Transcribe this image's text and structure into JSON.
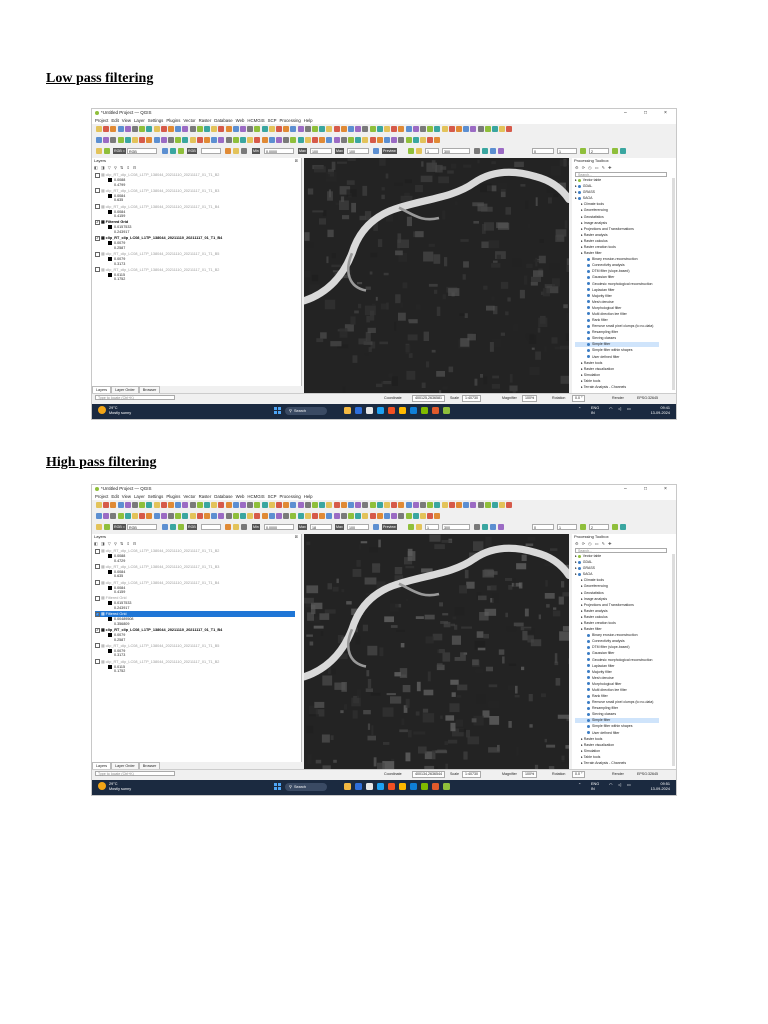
{
  "sections": [
    {
      "heading": "Low pass filtering",
      "qgis": {
        "window_title": "*Untitled Project — QGIS",
        "window_controls": [
          "–",
          "□",
          "×"
        ],
        "menu": [
          "Project",
          "Edit",
          "View",
          "Layer",
          "Settings",
          "Plugins",
          "Vector",
          "Raster",
          "Database",
          "Web",
          "HCMGIS",
          "SCP",
          "Processing",
          "Help"
        ],
        "toolbar3": {
          "rgb_label": "RGB =",
          "rgb_value": "RGB",
          "min_label": "Min",
          "min_value": "0.0000",
          "max_label": "Max",
          "max_value": "100",
          "max2_value": "100",
          "preview_label": "Preview",
          "band1": "1",
          "band2": "300",
          "band3": "0",
          "band4": "1",
          "band5": "2"
        },
        "layers_panel": {
          "title": "Layers",
          "tabs": [
            "Layers",
            "Layer Order",
            "Browser"
          ],
          "search_placeholder": "Type to locate (Ctrl+K)",
          "layers": [
            {
              "name": "clip_RT_clip_LC08_L1TP_138044_20211110_20211117_01_T1_B2",
              "checked": false,
              "style": "dim",
              "legend": [
                "0.0088",
                "0.4799"
              ]
            },
            {
              "name": "clip_RT_clip_LC08_L1TP_138044_20211110_20211117_01_T1_B3",
              "checked": false,
              "style": "dim",
              "legend": [
                "0.0084",
                "0.635"
              ]
            },
            {
              "name": "clip_RT_clip_LC08_L1TP_138044_20211110_20211117_01_T1_B4",
              "checked": false,
              "style": "dim",
              "legend": [
                "0.0084",
                "0.4159"
              ]
            },
            {
              "name": "Filtered Grid",
              "checked": true,
              "style": "bold",
              "legend": [
                "0.0157533",
                "0.243917"
              ]
            },
            {
              "name": "clip_RT_clip_LC08_L1TP_138044_20211110_20211117_01_T1_B4",
              "checked": true,
              "style": "bold",
              "legend": [
                "0.0079",
                "0.2587"
              ]
            },
            {
              "name": "clip_RT_clip_LC08_L1TP_138044_20211110_20211117_01_T1_B5",
              "checked": false,
              "style": "dim",
              "legend": [
                "0.0079",
                "0.3173"
              ]
            },
            {
              "name": "clip_RT_clip_LC08_L1TP_138044_20211110_20211117_01_T1_B2",
              "checked": false,
              "style": "dim",
              "legend": [
                "0.0115",
                "0.1752"
              ]
            }
          ]
        },
        "processing": {
          "title": "Processing Toolbox",
          "search_placeholder": "Search...",
          "tree": [
            {
              "label": "Vector table",
              "level": 0,
              "icon": "q"
            },
            {
              "label": "GDAL",
              "level": 0,
              "icon": "g"
            },
            {
              "label": "GRASS",
              "level": 0,
              "icon": "g"
            },
            {
              "label": "SAGA",
              "level": 0,
              "icon": "s"
            },
            {
              "label": "Climate tools",
              "level": 1
            },
            {
              "label": "Georeferencing",
              "level": 1
            },
            {
              "label": "Geostatistics",
              "level": 1
            },
            {
              "label": "Image analysis",
              "level": 1
            },
            {
              "label": "Projections and Transformations",
              "level": 1
            },
            {
              "label": "Raster analysis",
              "level": 1
            },
            {
              "label": "Raster calculus",
              "level": 1
            },
            {
              "label": "Raster creation tools",
              "level": 1
            },
            {
              "label": "Raster filter",
              "level": 1
            },
            {
              "label": "Binary erosion-reconstruction",
              "level": 2
            },
            {
              "label": "Connectivity analysis",
              "level": 2
            },
            {
              "label": "DTM filter (slope-based)",
              "level": 2
            },
            {
              "label": "Gaussian filter",
              "level": 2
            },
            {
              "label": "Geodesic morphological reconstruction",
              "level": 2
            },
            {
              "label": "Laplacian filter",
              "level": 2
            },
            {
              "label": "Majority filter",
              "level": 2
            },
            {
              "label": "Mesh denoise",
              "level": 2
            },
            {
              "label": "Morphological filter",
              "level": 2
            },
            {
              "label": "Multi direction lee filter",
              "level": 2
            },
            {
              "label": "Rank filter",
              "level": 2
            },
            {
              "label": "Remove small pixel clumps (to no-data)",
              "level": 2
            },
            {
              "label": "Resampling filter",
              "level": 2
            },
            {
              "label": "Sieving classes",
              "level": 2
            },
            {
              "label": "Simple filter",
              "level": 2,
              "highlight": true
            },
            {
              "label": "Simple filter within shapes",
              "level": 2
            },
            {
              "label": "User defined filter",
              "level": 2
            },
            {
              "label": "Raster tools",
              "level": 1
            },
            {
              "label": "Raster visualization",
              "level": 1
            },
            {
              "label": "Simulation",
              "level": 1
            },
            {
              "label": "Table tools",
              "level": 1
            },
            {
              "label": "Terrain Analysis - Channels",
              "level": 1
            }
          ]
        },
        "status": {
          "locate": "Type to locate (Ctrl+K)",
          "coordinate_label": "Coordinate",
          "coordinate": "400125,2636581",
          "scale_label": "Scale",
          "scale": "1:40730",
          "magnifier_label": "Magnifier",
          "magnifier": "100%",
          "rotation_label": "Rotation",
          "rotation": "0.0 °",
          "render_label": "Render",
          "crs": "EPSG:32645"
        },
        "taskbar": {
          "weather_temp": "29°C",
          "weather_desc": "Mostly sunny",
          "search": "Search",
          "lang": "ENG",
          "lang2": "IN",
          "time": "09:41",
          "date": "13-09-2024"
        }
      }
    },
    {
      "heading": "High pass filtering",
      "qgis": {
        "window_title": "*Untitled Project — QGIS",
        "window_controls": [
          "–",
          "□",
          "×"
        ],
        "menu": [
          "Project",
          "Edit",
          "View",
          "Layer",
          "Settings",
          "Plugins",
          "Vector",
          "Raster",
          "Database",
          "Web",
          "HCMGIS",
          "SCP",
          "Processing",
          "Help"
        ],
        "toolbar3": {
          "rgb_label": "RGB =",
          "rgb_value": "RGB",
          "min_label": "Min",
          "min_value": "0.0000",
          "max_label": "Max",
          "max_value": "18",
          "max2_value": "100",
          "preview_label": "Preview",
          "band1": "1",
          "band2": "300",
          "band3": "0",
          "band4": "1",
          "band5": "2"
        },
        "layers_panel": {
          "title": "Layers",
          "tabs": [
            "Layers",
            "Layer Order",
            "Browser"
          ],
          "search_placeholder": "Type to locate (Ctrl+K)",
          "layers": [
            {
              "name": "clip_RT_clip_LC08_L1TP_138044_20211110_20211117_01_T1_B2",
              "checked": false,
              "style": "dim",
              "legend": [
                "0.0088",
                "0.4729"
              ]
            },
            {
              "name": "clip_RT_clip_LC08_L1TP_138044_20211110_20211117_01_T1_B3",
              "checked": false,
              "style": "dim",
              "legend": [
                "0.0084",
                "0.635"
              ]
            },
            {
              "name": "clip_RT_clip_LC08_L1TP_138044_20211110_20211117_01_T1_B4",
              "checked": false,
              "style": "dim",
              "legend": [
                "0.0084",
                "0.4159"
              ]
            },
            {
              "name": "Filtered Grid",
              "checked": false,
              "style": "dim",
              "legend": [
                "0.0157533",
                "0.243917"
              ]
            },
            {
              "name": "Filtered Grid",
              "checked": true,
              "style": "sel",
              "legend": [
                "0.00489508",
                "0.356809"
              ]
            },
            {
              "name": "clip_RT_clip_LC08_L1TP_138044_20211110_20211117_01_T1_B4",
              "checked": true,
              "style": "bold",
              "legend": [
                "0.0079",
                "0.2587"
              ]
            },
            {
              "name": "clip_RT_clip_LC08_L1TP_138044_20211110_20211117_01_T1_B5",
              "checked": false,
              "style": "dim",
              "legend": [
                "0.0079",
                "0.3173"
              ]
            },
            {
              "name": "clip_RT_clip_LC08_L1TP_138044_20211110_20211117_01_T1_B2",
              "checked": false,
              "style": "dim",
              "legend": [
                "0.0115",
                "0.1752"
              ]
            }
          ]
        },
        "processing": {
          "title": "Processing Toolbox",
          "search_placeholder": "Search...",
          "tree": [
            {
              "label": "Vector table",
              "level": 0,
              "icon": "q"
            },
            {
              "label": "GDAL",
              "level": 0,
              "icon": "g"
            },
            {
              "label": "GRASS",
              "level": 0,
              "icon": "g"
            },
            {
              "label": "SAGA",
              "level": 0,
              "icon": "s"
            },
            {
              "label": "Climate tools",
              "level": 1
            },
            {
              "label": "Georeferencing",
              "level": 1
            },
            {
              "label": "Geostatistics",
              "level": 1
            },
            {
              "label": "Image analysis",
              "level": 1
            },
            {
              "label": "Projections and Transformations",
              "level": 1
            },
            {
              "label": "Raster analysis",
              "level": 1
            },
            {
              "label": "Raster calculus",
              "level": 1
            },
            {
              "label": "Raster creation tools",
              "level": 1
            },
            {
              "label": "Raster filter",
              "level": 1
            },
            {
              "label": "Binary erosion-reconstruction",
              "level": 2
            },
            {
              "label": "Connectivity analysis",
              "level": 2
            },
            {
              "label": "DTM filter (slope-based)",
              "level": 2
            },
            {
              "label": "Gaussian filter",
              "level": 2
            },
            {
              "label": "Geodesic morphological reconstruction",
              "level": 2
            },
            {
              "label": "Laplacian filter",
              "level": 2
            },
            {
              "label": "Majority filter",
              "level": 2
            },
            {
              "label": "Mesh denoise",
              "level": 2
            },
            {
              "label": "Morphological filter",
              "level": 2
            },
            {
              "label": "Multi direction lee filter",
              "level": 2
            },
            {
              "label": "Rank filter",
              "level": 2
            },
            {
              "label": "Remove small pixel clumps (to no-data)",
              "level": 2
            },
            {
              "label": "Resampling filter",
              "level": 2
            },
            {
              "label": "Sieving classes",
              "level": 2
            },
            {
              "label": "Simple filter",
              "level": 2,
              "highlight": true
            },
            {
              "label": "Simple filter within shapes",
              "level": 2
            },
            {
              "label": "User defined filter",
              "level": 2
            },
            {
              "label": "Raster tools",
              "level": 1
            },
            {
              "label": "Raster visualization",
              "level": 1
            },
            {
              "label": "Simulation",
              "level": 1
            },
            {
              "label": "Table tools",
              "level": 1
            },
            {
              "label": "Terrain Analysis - Channels",
              "level": 1
            }
          ]
        },
        "status": {
          "locate": "Type to locate (Ctrl+K)",
          "coordinate_label": "Coordinate",
          "coordinate": "400134,2636544",
          "scale_label": "Scale",
          "scale": "1:40730",
          "magnifier_label": "Magnifier",
          "magnifier": "100%",
          "rotation_label": "Rotation",
          "rotation": "0.0 °",
          "render_label": "Render",
          "crs": "EPSG:32645"
        },
        "taskbar": {
          "weather_temp": "29°C",
          "weather_desc": "Mostly sunny",
          "search": "Search",
          "lang": "ENG",
          "lang2": "IN",
          "time": "09:51",
          "date": "13-09-2024"
        }
      }
    }
  ]
}
